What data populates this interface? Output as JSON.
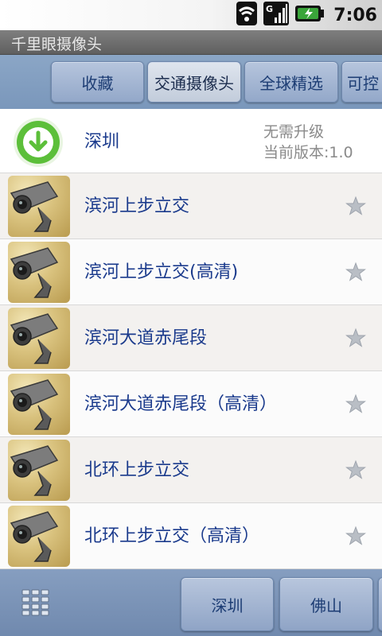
{
  "status": {
    "time": "7:06"
  },
  "app": {
    "title": "千里眼摄像头"
  },
  "top_tabs": [
    {
      "label": "收藏"
    },
    {
      "label": "交通摄像头"
    },
    {
      "label": "全球精选"
    },
    {
      "label": "可控"
    }
  ],
  "region": {
    "name": "深圳",
    "upgrade_status": "无需升级",
    "version": "当前版本:1.0"
  },
  "cameras": [
    {
      "name": "滨河上步立交"
    },
    {
      "name": "滨河上步立交(高清)"
    },
    {
      "name": "滨河大道赤尾段"
    },
    {
      "name": "滨河大道赤尾段（高清）"
    },
    {
      "name": "北环上步立交"
    },
    {
      "name": "北环上步立交（高清）"
    }
  ],
  "bottom_tabs": [
    {
      "label": "深圳"
    },
    {
      "label": "佛山"
    }
  ],
  "colors": {
    "accent": "#1a3a8c",
    "tabbar": "#7f9bbf",
    "download_green": "#5cbf3a"
  }
}
